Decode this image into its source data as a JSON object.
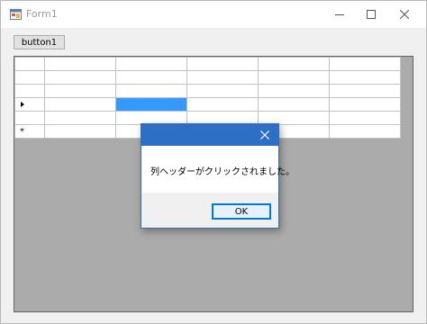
{
  "window": {
    "title": "Form1"
  },
  "toolbar": {
    "button1_label": "button1"
  },
  "grid": {
    "rows": 6,
    "columns": 5,
    "selected_cell": {
      "row": 4,
      "column": 2
    },
    "selected_color": "#3399ff"
  },
  "dialog": {
    "message": "列ヘッダーがクリックされました。",
    "ok_label": "OK",
    "title_bar_color": "#2c6fc4"
  },
  "icons": {
    "app": "form-app-icon",
    "minimize": "minimize-icon",
    "maximize": "maximize-icon",
    "close": "close-icon",
    "current_row": "row-pointer-icon",
    "new_row": "new-row-star-icon",
    "dialog_close": "close-icon"
  }
}
